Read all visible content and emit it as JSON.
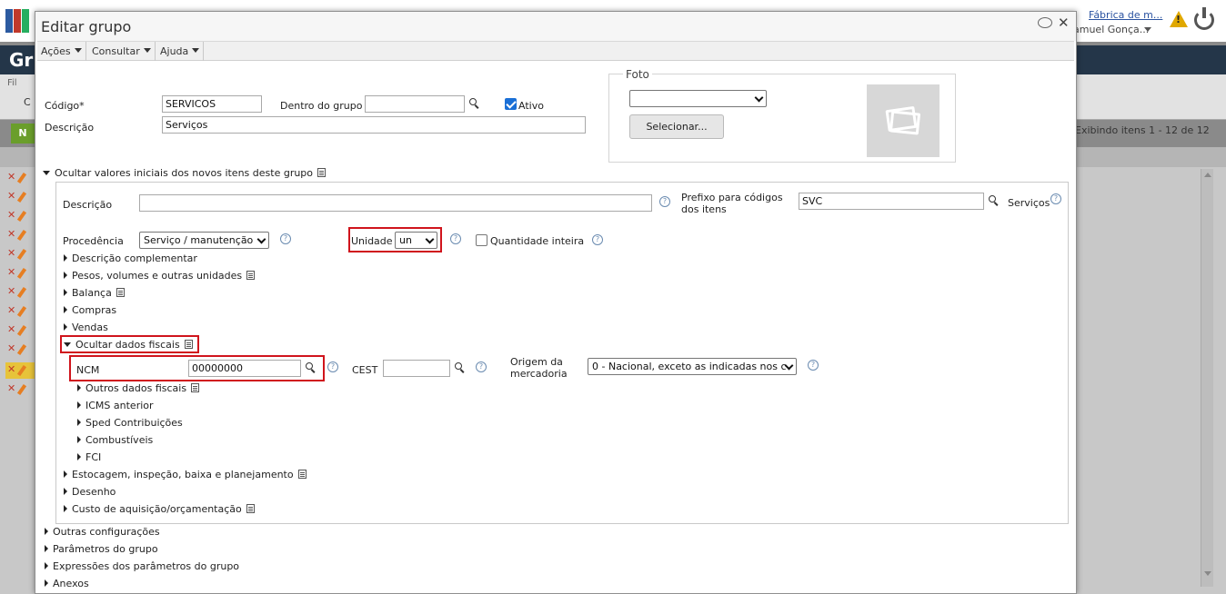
{
  "app": {
    "company": "Fábrica de m...",
    "user": "amuel Gonça...",
    "page_title_fragment": "Gr",
    "filter_label_fragment": "Fil",
    "filter_c_fragment": "C",
    "new_button_fragment": "N",
    "exhibit_text": "Exibindo itens 1 - 12 de 12"
  },
  "modal": {
    "title": "Editar grupo",
    "menu": {
      "acoes": "Ações",
      "consultar": "Consultar",
      "ajuda": "Ajuda"
    }
  },
  "form": {
    "codigo_label": "Código*",
    "codigo_value": "SERVICOS",
    "dentro_label": "Dentro do grupo",
    "dentro_value": "",
    "ativo_label": "Ativo",
    "ativo_checked": true,
    "descricao_label": "Descrição",
    "descricao_value": "Serviços",
    "foto_legend": "Foto",
    "foto_select_value": "",
    "foto_button": "Selecionar..."
  },
  "initial_values": {
    "section_label": "Ocultar valores iniciais dos novos itens deste grupo",
    "descricao_label": "Descrição",
    "descricao_value": "",
    "prefixo_label_1": "Prefixo para códigos",
    "prefixo_label_2": "dos itens",
    "prefixo_value": "SVC",
    "prefixo_lookup": "Serviços",
    "procedencia_label": "Procedência",
    "procedencia_value": "Serviço / manutenção",
    "unidade_label": "Unidade",
    "unidade_value": "un",
    "quantidade_label": "Quantidade inteira",
    "quantidade_checked": false,
    "sections": [
      "Descrição complementar",
      "Pesos, volumes e outras unidades",
      "Balança",
      "Compras",
      "Vendas"
    ],
    "fiscal": {
      "section_label": "Ocultar dados fiscais",
      "ncm_label": "NCM",
      "ncm_value": "00000000",
      "cest_label": "CEST",
      "cest_value": "",
      "origem_label_1": "Origem da",
      "origem_label_2": "mercadoria",
      "origem_value": "0 - Nacional, exceto as indicadas nos c",
      "subsections": [
        "Outros dados fiscais",
        "ICMS anterior",
        "Sped Contribuições",
        "Combustíveis",
        "FCI"
      ]
    },
    "more_sections": [
      "Estocagem, inspeção, baixa e planejamento",
      "Desenho",
      "Custo de aquisição/orçamentação"
    ]
  },
  "bottom_sections": [
    "Outras configurações",
    "Parâmetros do grupo",
    "Expressões dos parâmetros do grupo",
    "Anexos"
  ],
  "colors": {
    "header_dark": "#243649",
    "highlight_red": "#d0141c",
    "checkbox_blue": "#1a6fd6",
    "new_button_green": "#6a9e2b",
    "warning_yellow": "#e0a800"
  },
  "icons": [
    "app-logo-icon",
    "warning-icon",
    "power-icon",
    "chat-icon",
    "close-icon",
    "search-icon",
    "help-icon",
    "document-icon",
    "image-placeholder-icon",
    "delete-icon",
    "edit-icon"
  ]
}
